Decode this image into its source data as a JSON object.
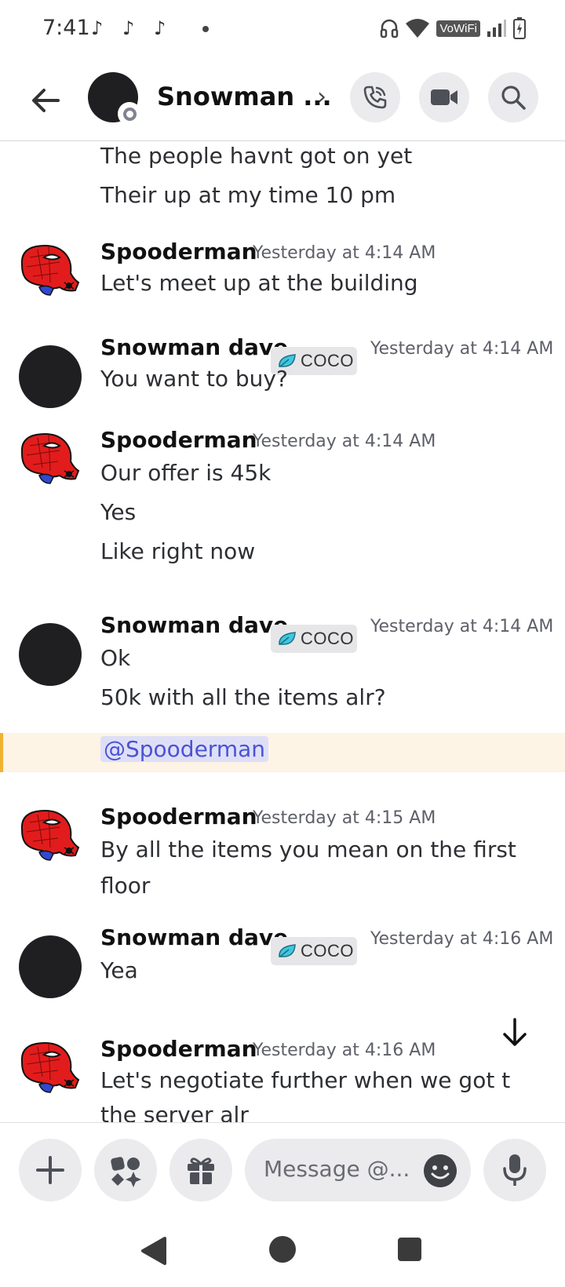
{
  "status_bar": {
    "time": "7:41",
    "notif_icons": [
      "tiktok-icon",
      "tiktok-icon",
      "tiktok-icon"
    ],
    "vowifi": "VoWiFi"
  },
  "header": {
    "title": "Snowman ...",
    "chevron": "›",
    "buttons": [
      "call-icon",
      "video-icon",
      "search-icon"
    ]
  },
  "messages": [
    {
      "continued": true,
      "lines": [
        "The people havnt got on yet",
        "Their up at my time 10 pm"
      ]
    },
    {
      "author": "Spooderman",
      "time": "Yesterday at 4:14 AM",
      "lines": [
        "Let's meet up at the building"
      ]
    },
    {
      "author": "Snowman dave",
      "tag": "COCO",
      "time": "Yesterday at 4:14 AM",
      "lines": [
        "You want to buy?"
      ]
    },
    {
      "author": "Spooderman",
      "time": "Yesterday at 4:14 AM",
      "lines": [
        "Our offer is 45k",
        "Yes",
        "Like right now"
      ]
    },
    {
      "author": "Snowman dave",
      "tag": "COCO",
      "time": "Yesterday at 4:14 AM",
      "lines": [
        "Ok",
        "50k with all the items alr?"
      ],
      "mention": "@Spooderman"
    },
    {
      "author": "Spooderman",
      "time": "Yesterday at 4:15 AM",
      "lines": [
        "By all the items you mean on the first",
        "floor"
      ]
    },
    {
      "author": "Snowman dave",
      "tag": "COCO",
      "time": "Yesterday at 4:16 AM",
      "lines": [
        "Yea"
      ]
    },
    {
      "author": "Spooderman",
      "time": "Yesterday at 4:16 AM",
      "lines": [
        "Let's negotiate further when we got t",
        "the server alr"
      ]
    }
  ],
  "composer": {
    "placeholder": "Message @...",
    "buttons": [
      "plus-icon",
      "apps-icon",
      "gift-icon",
      "emoji-icon",
      "mic-icon"
    ]
  },
  "colors": {
    "accent": "#5865f2",
    "mention_bg": "#fdf4e6",
    "mention_bar": "#f0b232",
    "mention_text": "#4a53d4",
    "tag_leaf": "#3fc7e0"
  }
}
